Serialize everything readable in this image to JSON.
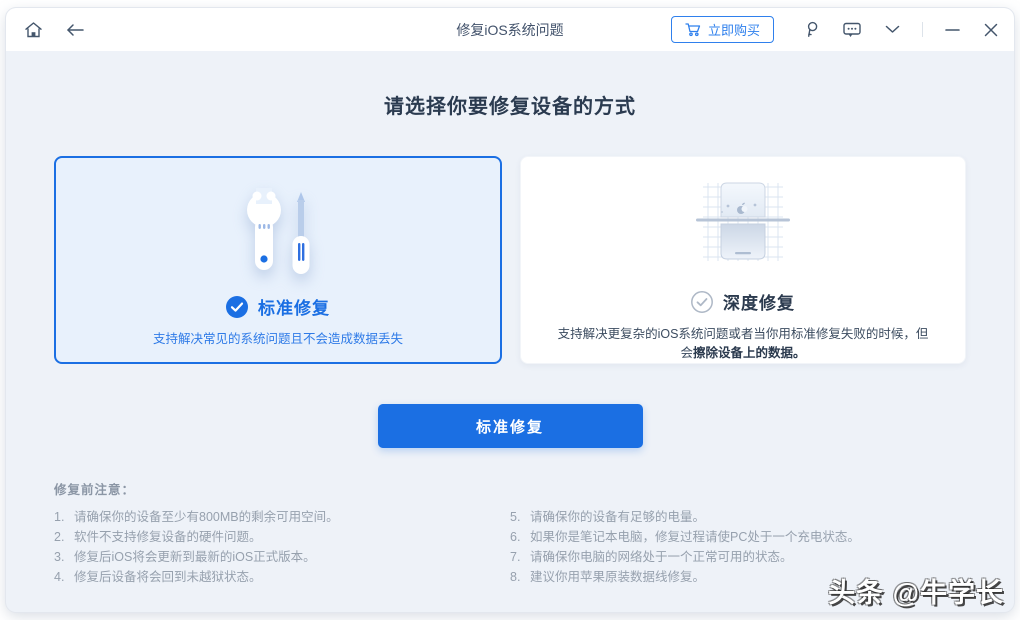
{
  "titlebar": {
    "title": "修复iOS系统问题",
    "buy_label": "立即购买"
  },
  "main": {
    "heading": "请选择你要修复设备的方式",
    "cards": {
      "standard": {
        "title": "标准修复",
        "desc": "支持解决常见的系统问题且不会造成数据丢失",
        "selected": true
      },
      "deep": {
        "title": "深度修复",
        "desc_normal": "支持解决更复杂的iOS系统问题或者当你用标准修复失败的时候，但会",
        "desc_bold": "擦除设备上的数据。",
        "selected": false
      }
    },
    "action_label": "标准修复"
  },
  "notes": {
    "heading": "修复前注意：",
    "left": [
      {
        "num": "1.",
        "text": "请确保你的设备至少有800MB的剩余可用空间。"
      },
      {
        "num": "2.",
        "text": "软件不支持修复设备的硬件问题。"
      },
      {
        "num": "3.",
        "text": "修复后iOS将会更新到最新的iOS正式版本。"
      },
      {
        "num": "4.",
        "text": "修复后设备将会回到未越狱状态。"
      }
    ],
    "right": [
      {
        "num": "5.",
        "text": "请确保你的设备有足够的电量。"
      },
      {
        "num": "6.",
        "text": "如果你是笔记本电脑，修复过程请使PC处于一个充电状态。"
      },
      {
        "num": "7.",
        "text": "请确保你电脑的网络处于一个正常可用的状态。"
      },
      {
        "num": "8.",
        "text": "建议你用苹果原装数据线修复。"
      }
    ]
  },
  "watermark": "头条 @牛学长",
  "colors": {
    "accent_blue": "#1b6fe3",
    "buy_outline_blue": "#2f80ed",
    "selected_card_bg": "#e8f1fc",
    "content_bg": "#eef2f8",
    "titlebar_bg": "#ffffff",
    "heading_dark": "#2b3b50",
    "note_gray": "#97a1ae",
    "icon_gray": "#44566c"
  }
}
